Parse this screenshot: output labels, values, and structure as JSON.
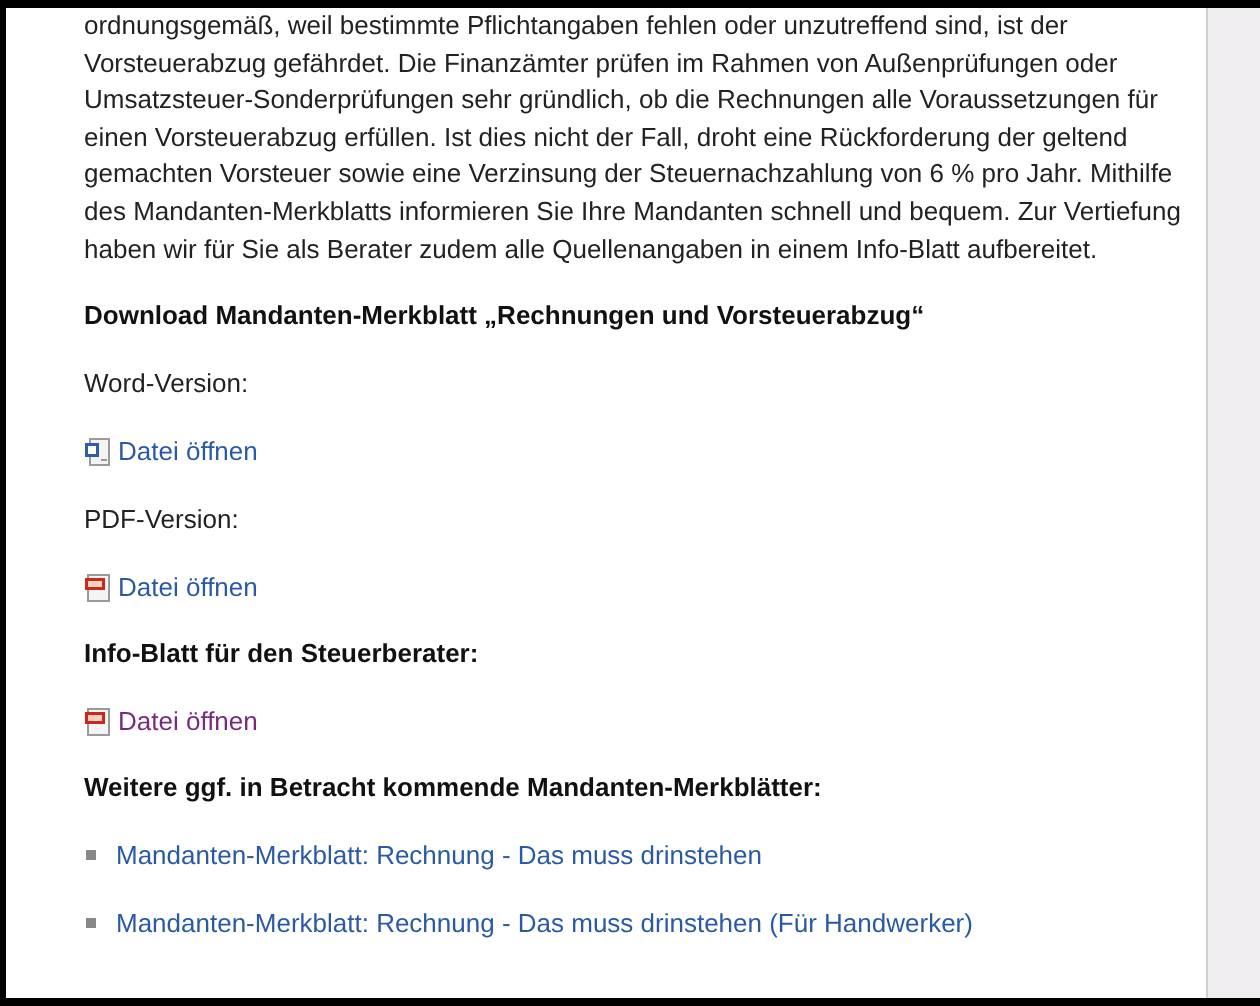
{
  "intro_paragraph": "ordnungsgemäß, weil bestimmte Pflichtangaben fehlen oder unzutreffend sind, ist der Vorsteuerabzug gefährdet. Die Finanzämter prüfen im Rahmen von Außenprüfungen oder Umsatzsteuer-Sonderprüfungen sehr gründlich, ob die Rechnungen alle Voraussetzungen für einen Vorsteuerabzug erfüllen. Ist dies nicht der Fall, droht eine Rückforderung der geltend gemachten Vorsteuer sowie eine Verzinsung der Steuernachzahlung von 6 % pro Jahr. Mithilfe des Mandanten-Merkblatts informieren Sie Ihre Mandanten schnell und bequem. Zur Vertiefung haben wir für Sie als Berater zudem alle Quellenangaben in einem Info-Blatt aufbereitet.",
  "sections": [
    {
      "kind": "heading",
      "text": "Download Mandanten-Merkblatt „Rechnungen und Vorsteuerabzug“"
    },
    {
      "kind": "label",
      "text": "Word-Version:"
    },
    {
      "kind": "word_link",
      "text": "Datei öffnen",
      "visited": false
    },
    {
      "kind": "label",
      "text": "PDF-Version:"
    },
    {
      "kind": "pdf_link",
      "text": "Datei öffnen",
      "visited": false
    },
    {
      "kind": "heading",
      "text": "Info-Blatt für den Steuerberater:"
    },
    {
      "kind": "pdf_link",
      "text": "Datei öffnen",
      "visited": true
    },
    {
      "kind": "heading",
      "text": "Weitere ggf. in Betracht kommende Mandanten-Merkblätter:"
    },
    {
      "kind": "bullet_link",
      "text": "Mandanten-Merkblatt: Rechnung - Das muss drinstehen",
      "visited": false
    },
    {
      "kind": "bullet_link",
      "text": "Mandanten-Merkblatt: Rechnung - Das muss drinstehen (Für Handwerker)",
      "visited": false
    }
  ]
}
